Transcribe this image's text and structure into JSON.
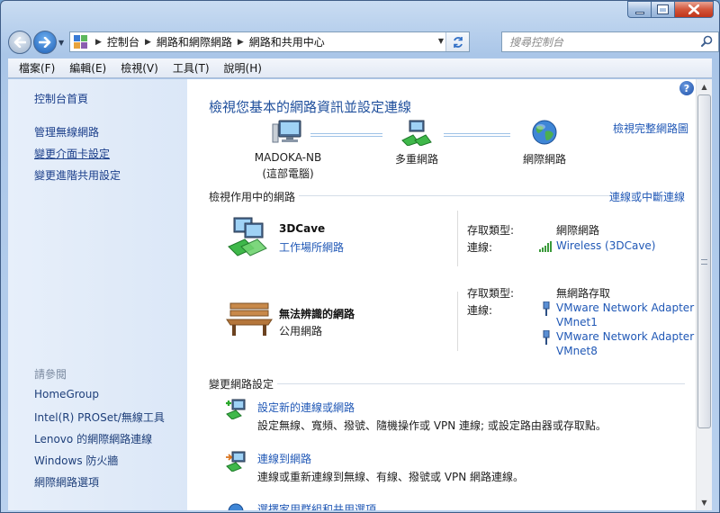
{
  "menu": [
    "檔案(F)",
    "編輯(E)",
    "檢視(V)",
    "工具(T)",
    "說明(H)"
  ],
  "address": {
    "crumbs": [
      "控制台",
      "網路和網際網路",
      "網路和共用中心"
    ]
  },
  "search": {
    "placeholder": "搜尋控制台"
  },
  "left_pane": {
    "links": [
      "控制台首頁",
      "管理無線網路",
      "變更介面卡設定",
      "變更進階共用設定"
    ],
    "see_also_heading": "請參閱",
    "see_also": [
      "HomeGroup",
      "Intel(R) PROSet/無線工具",
      "Lenovo 的網際網路連線",
      "Windows 防火牆",
      "網際網路選項"
    ]
  },
  "main": {
    "title": "檢視您基本的網路資訊並設定連線",
    "view_full_map": "檢視完整網路圖",
    "map": [
      {
        "label": "MADOKA-NB",
        "sublabel": "(這部電腦)"
      },
      {
        "label": "多重網路",
        "sublabel": ""
      },
      {
        "label": "網際網路",
        "sublabel": ""
      }
    ],
    "active_section": {
      "title": "檢視作用中的網路",
      "link": "連線或中斷連線"
    },
    "networks": [
      {
        "name": "3DCave",
        "type": "工作場所網路",
        "access_label": "存取類型:",
        "access_value": "網際網路",
        "conn_label": "連線:",
        "connections": [
          "Wireless (3DCave)"
        ]
      },
      {
        "name": "無法辨識的網路",
        "type": "公用網路",
        "access_label": "存取類型:",
        "access_value": "無網路存取",
        "conn_label": "連線:",
        "connections": [
          "VMware Network Adapter VMnet1",
          "VMware Network Adapter VMnet8"
        ]
      }
    ],
    "change_section": {
      "title": "變更網路設定"
    },
    "tasks": [
      {
        "link": "設定新的連線或網路",
        "desc": "設定無線、寬頻、撥號、隨機操作或 VPN 連線; 或設定路由器或存取點。"
      },
      {
        "link": "連線到網路",
        "desc": "連線或重新連線到無線、有線、撥號或 VPN 網路連線。"
      },
      {
        "link": "選擇家用群組和共用選項",
        "desc": ""
      }
    ]
  },
  "colors": {
    "accent": "#2058b6",
    "title": "#1f4f9c",
    "left_pane": "#e7effa"
  }
}
